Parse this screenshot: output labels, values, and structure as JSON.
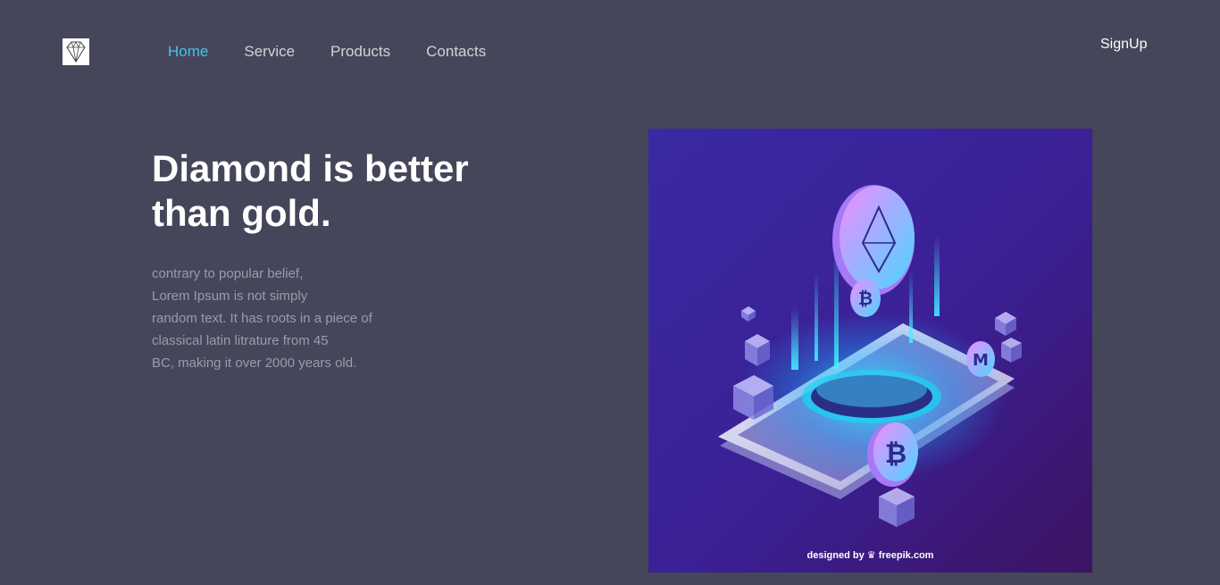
{
  "header": {
    "logo_icon": "diamond-icon",
    "nav": [
      {
        "label": "Home",
        "active": true
      },
      {
        "label": "Service",
        "active": false
      },
      {
        "label": "Products",
        "active": false
      },
      {
        "label": "Contacts",
        "active": false
      }
    ],
    "signup_label": "SignUp"
  },
  "hero": {
    "title_line1": "Diamond is better",
    "title_line2": "than gold.",
    "paragraph_lines": [
      "contrary to popular belief,",
      "Lorem Ipsum is not simply",
      "random text. It has roots in a piece of",
      "classical latin litrature from 45",
      "BC, making it over 2000 years old."
    ]
  },
  "illustration": {
    "credit": "designed by ♛ freepik.com"
  },
  "colors": {
    "background": "#454659",
    "nav_active": "#3fc6ec",
    "nav_inactive": "#d3d3d8",
    "title": "#ffffff",
    "body_text": "#9a9baa"
  }
}
